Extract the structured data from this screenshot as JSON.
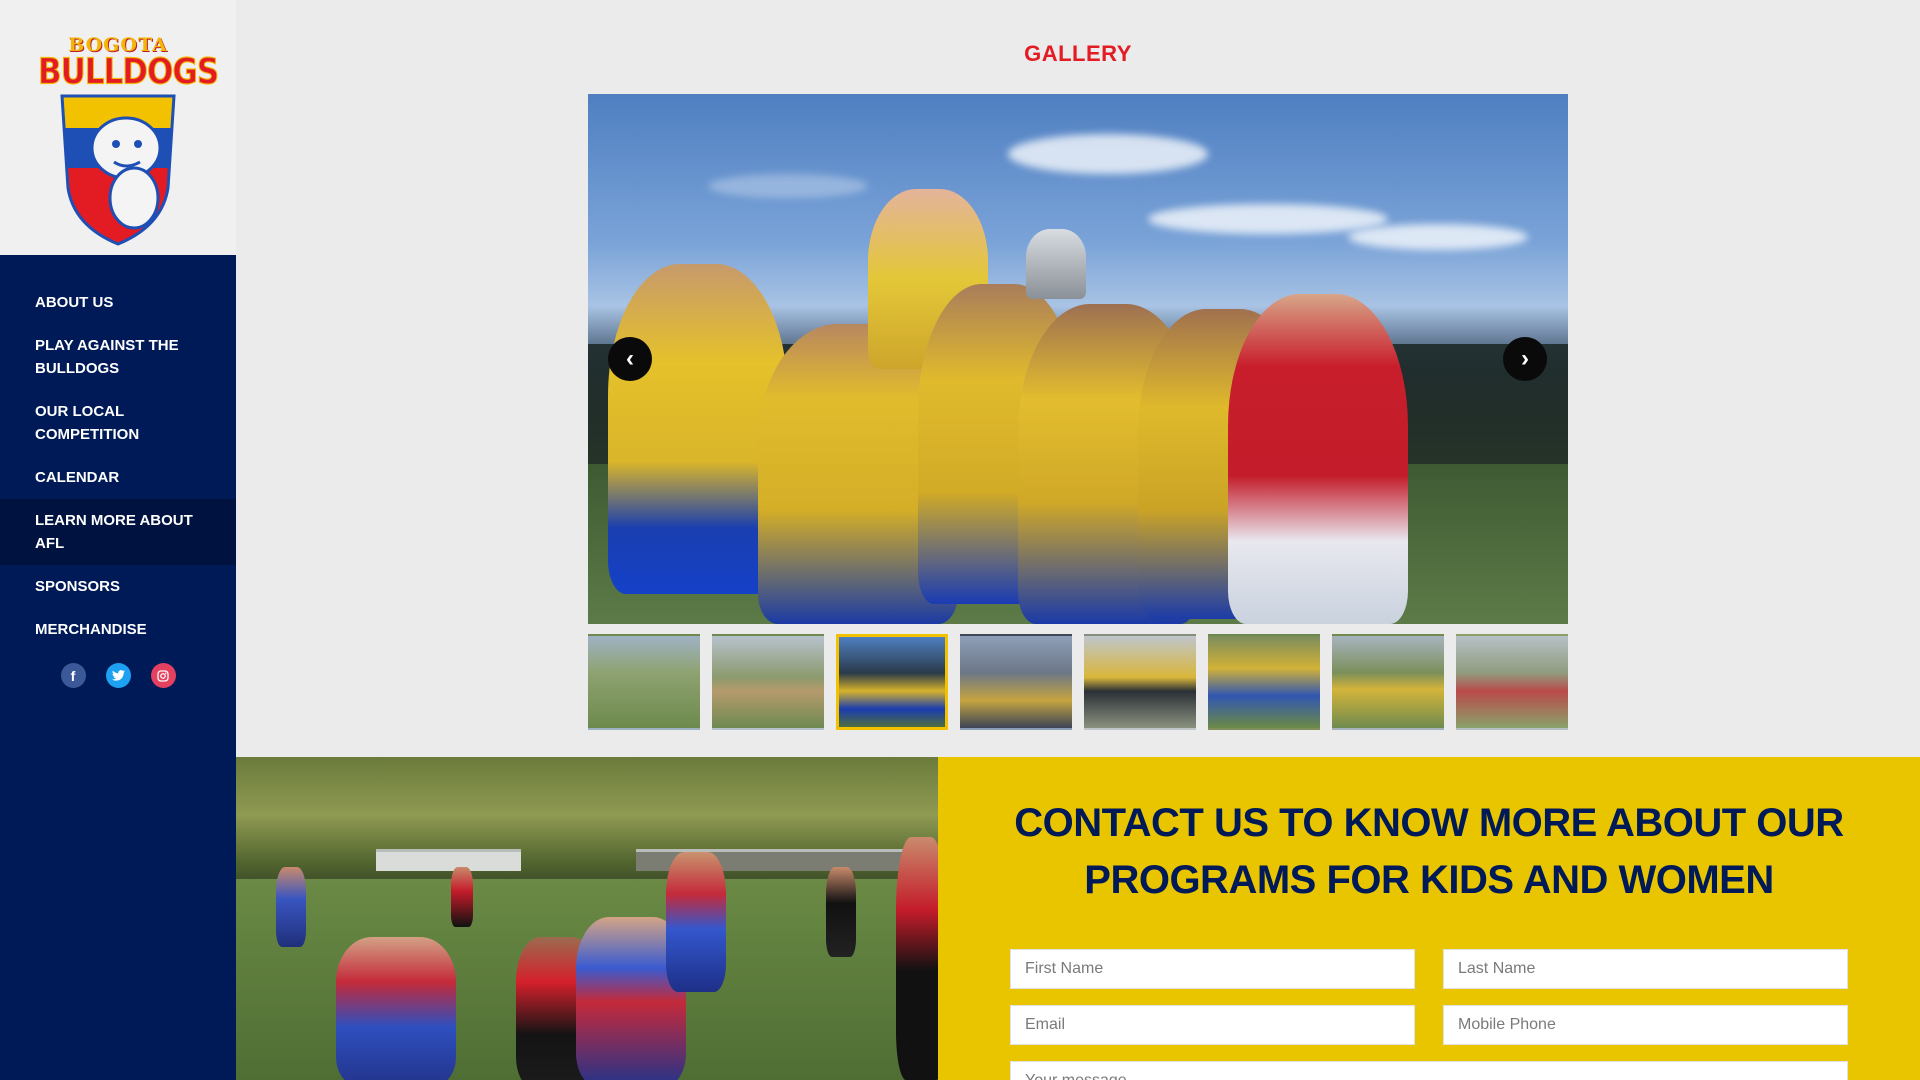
{
  "logo": {
    "line1": "BOGOTA",
    "line2": "BULLDOGS"
  },
  "sidebar": {
    "items": [
      {
        "label": "ABOUT US",
        "active": false
      },
      {
        "label": "PLAY AGAINST THE BULLDOGS",
        "active": false
      },
      {
        "label": "OUR LOCAL COMPETITION",
        "active": false
      },
      {
        "label": "CALENDAR",
        "active": false
      },
      {
        "label": "LEARN MORE ABOUT AFL",
        "active": true
      },
      {
        "label": "SPONSORS",
        "active": false
      },
      {
        "label": "MERCHANDISE",
        "active": false
      }
    ],
    "social": [
      {
        "icon": "facebook-icon",
        "glyph": "f"
      },
      {
        "icon": "twitter-icon",
        "glyph": "t"
      },
      {
        "icon": "instagram-icon",
        "glyph": "◎"
      }
    ]
  },
  "gallery": {
    "title": "GALLERY",
    "prev_glyph": "‹",
    "next_glyph": "›",
    "thumb_count": 8,
    "active_thumb": 3
  },
  "contact": {
    "heading": "CONTACT US TO KNOW MORE ABOUT OUR PROGRAMS FOR KIDS AND WOMEN",
    "first_name_placeholder": "First Name",
    "last_name_placeholder": "Last Name",
    "email_placeholder": "Email",
    "phone_placeholder": "Mobile Phone",
    "message_placeholder": "Your message"
  },
  "colors": {
    "navy": "#001a57",
    "red": "#e31b23",
    "yellow": "#e9c500",
    "thumb_highlight": "#f2c200"
  }
}
